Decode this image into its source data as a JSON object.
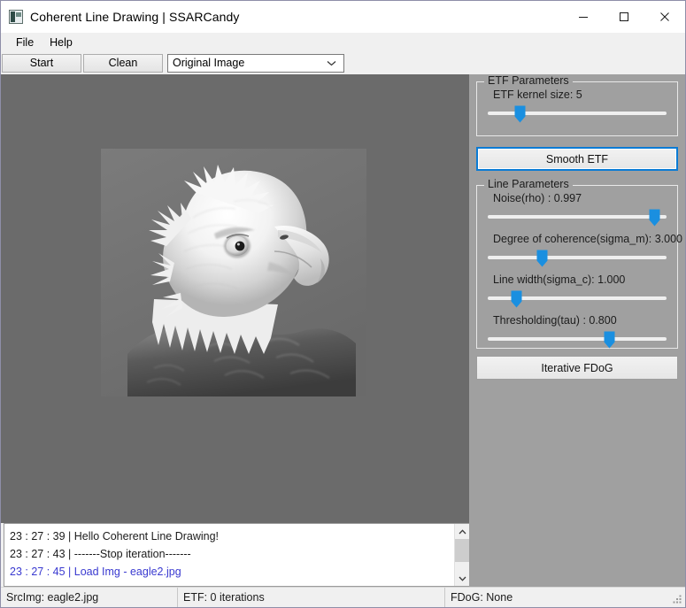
{
  "window": {
    "title": "Coherent Line Drawing | SSARCandy",
    "icon": "image-app-icon",
    "controls": {
      "minimize": "minimize-icon",
      "maximize": "maximize-icon",
      "close": "close-icon"
    }
  },
  "menu": {
    "items": [
      {
        "label": "File"
      },
      {
        "label": "Help"
      }
    ]
  },
  "toolbar": {
    "start_label": "Start",
    "clean_label": "Clean",
    "view_select": {
      "value": "Original Image",
      "arrow_icon": "chevron-down-icon"
    }
  },
  "canvas": {
    "image_alt": "Grayscale photograph of a bald eagle head in profile",
    "background_color": "#6b6b6b"
  },
  "log": {
    "lines": [
      {
        "text": "23 : 27 : 39  |  Hello Coherent Line Drawing!",
        "style": "normal"
      },
      {
        "text": "23 : 27 : 43  |  -------Stop iteration-------",
        "style": "normal"
      },
      {
        "text": "23 : 27 : 45  |  Load Img - eagle2.jpg",
        "style": "link"
      }
    ],
    "scrollbar": {
      "up_icon": "chevron-up-icon",
      "down_icon": "chevron-down-icon"
    }
  },
  "panel": {
    "etf_group": {
      "title": "ETF Parameters",
      "sliders": [
        {
          "label": "ETF kernel size: 5",
          "value": 5,
          "percent": 18
        }
      ]
    },
    "smooth_button": {
      "label": "Smooth ETF",
      "focused": true
    },
    "line_group": {
      "title": "Line Parameters",
      "sliders": [
        {
          "label": "Noise(rho) : 0.997",
          "value": 0.997,
          "percent": 93
        },
        {
          "label": "Degree of coherence(sigma_m): 3.000",
          "value": 3.0,
          "percent": 30
        },
        {
          "label": "Line width(sigma_c): 1.000",
          "value": 1.0,
          "percent": 16
        },
        {
          "label": "Thresholding(tau) : 0.800",
          "value": 0.8,
          "percent": 68
        }
      ]
    },
    "fdog_button": {
      "label": "Iterative FDoG",
      "focused": false
    },
    "accent_color": "#1a8fe0",
    "background_color": "#a0a0a0"
  },
  "statusbar": {
    "src_image": "SrcImg: eagle2.jpg",
    "etf_status": "ETF: 0 iterations",
    "fdog_status": "FDoG: None",
    "grip_icon": "resize-grip-icon"
  }
}
